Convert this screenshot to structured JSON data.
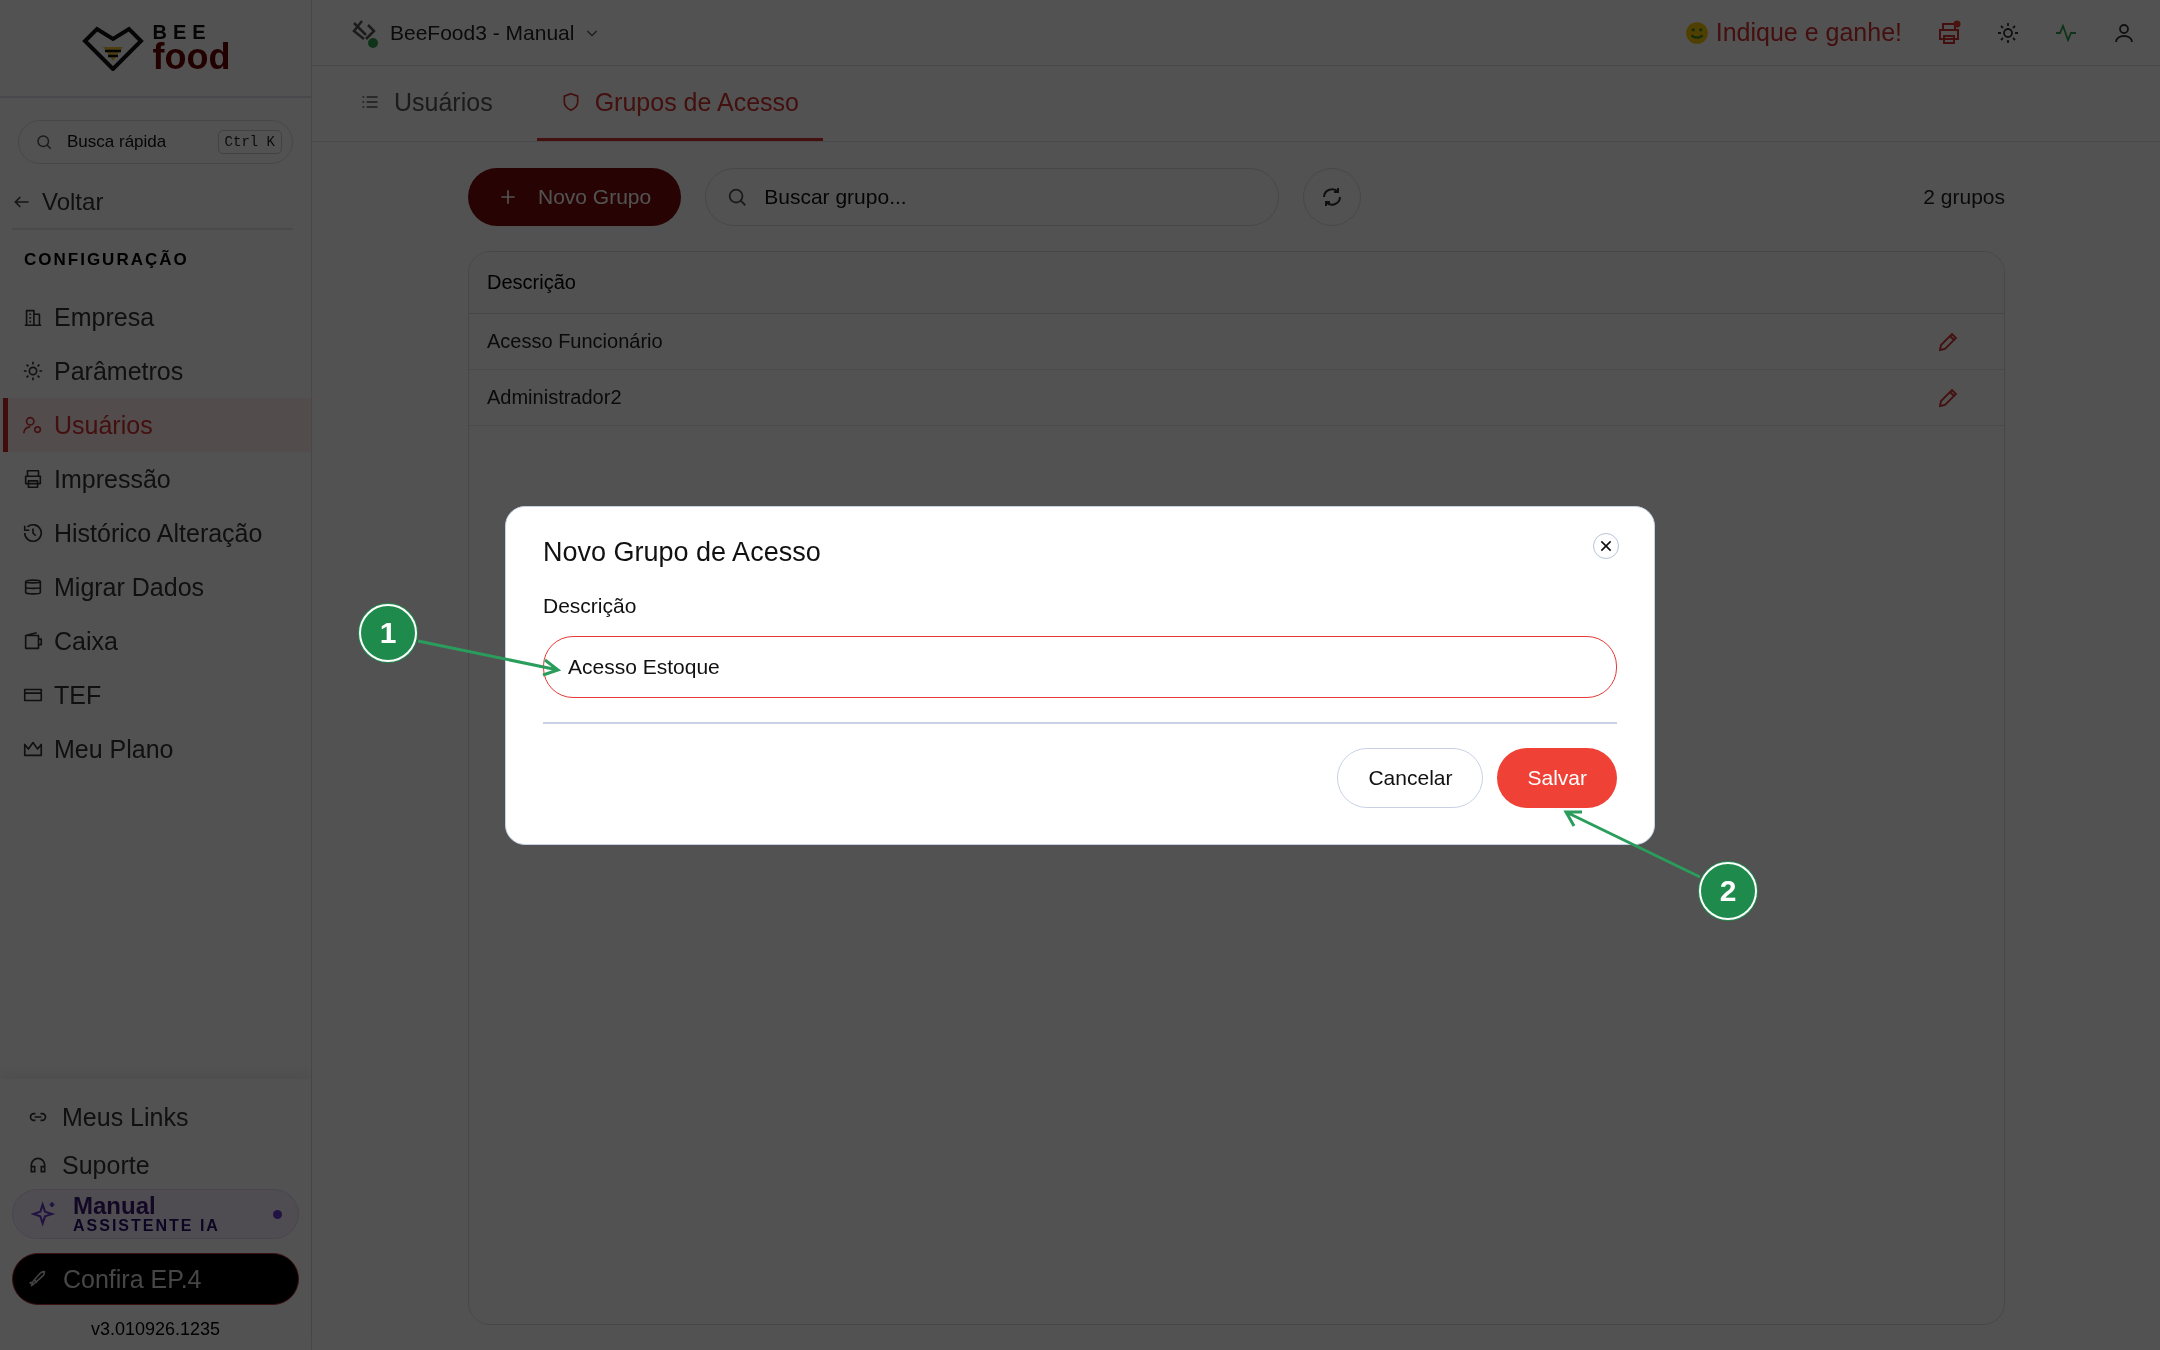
{
  "brand": {
    "top": "BEE",
    "bottom": "food"
  },
  "quick_search": {
    "placeholder": "Busca rápida",
    "shortcut": "Ctrl K"
  },
  "back": "Voltar",
  "section": "CONFIGURAÇÃO",
  "sidebar": {
    "items": [
      {
        "label": "Empresa",
        "selected": false
      },
      {
        "label": "Parâmetros",
        "selected": false
      },
      {
        "label": "Usuários",
        "selected": true
      },
      {
        "label": "Impressão",
        "selected": false
      },
      {
        "label": "Histórico Alteração",
        "selected": false
      },
      {
        "label": "Migrar Dados",
        "selected": false
      },
      {
        "label": "Caixa",
        "selected": false
      },
      {
        "label": "TEF",
        "selected": false
      },
      {
        "label": "Meu Plano",
        "selected": false
      }
    ]
  },
  "footer_links": [
    "Meus Links",
    "Suporte"
  ],
  "assistant": {
    "title": "Manual",
    "subtitle": "ASSISTENTE IA"
  },
  "promo_button": "Confira EP.4",
  "version": "v3.010926.1235",
  "topbar": {
    "workspace": "BeeFood3 - Manual",
    "referral": "Indique e ganhe!"
  },
  "tabs": [
    {
      "label": "Usuários",
      "selected": false
    },
    {
      "label": "Grupos de Acesso",
      "selected": true
    }
  ],
  "toolbar": {
    "new_button": "Novo Grupo",
    "search_placeholder": "Buscar grupo...",
    "count": "2 grupos"
  },
  "table": {
    "columns": [
      "Descrição"
    ],
    "rows": [
      "Acesso Funcionário",
      "Administrador2"
    ]
  },
  "dialog": {
    "title": "Novo Grupo de Acesso",
    "field_label": "Descrição",
    "field_value": "Acesso Estoque",
    "buttons": [
      {
        "label": "Cancelar",
        "kind": "secondary"
      },
      {
        "label": "Salvar",
        "kind": "primary"
      }
    ]
  },
  "annotations": [
    "1",
    "2"
  ]
}
